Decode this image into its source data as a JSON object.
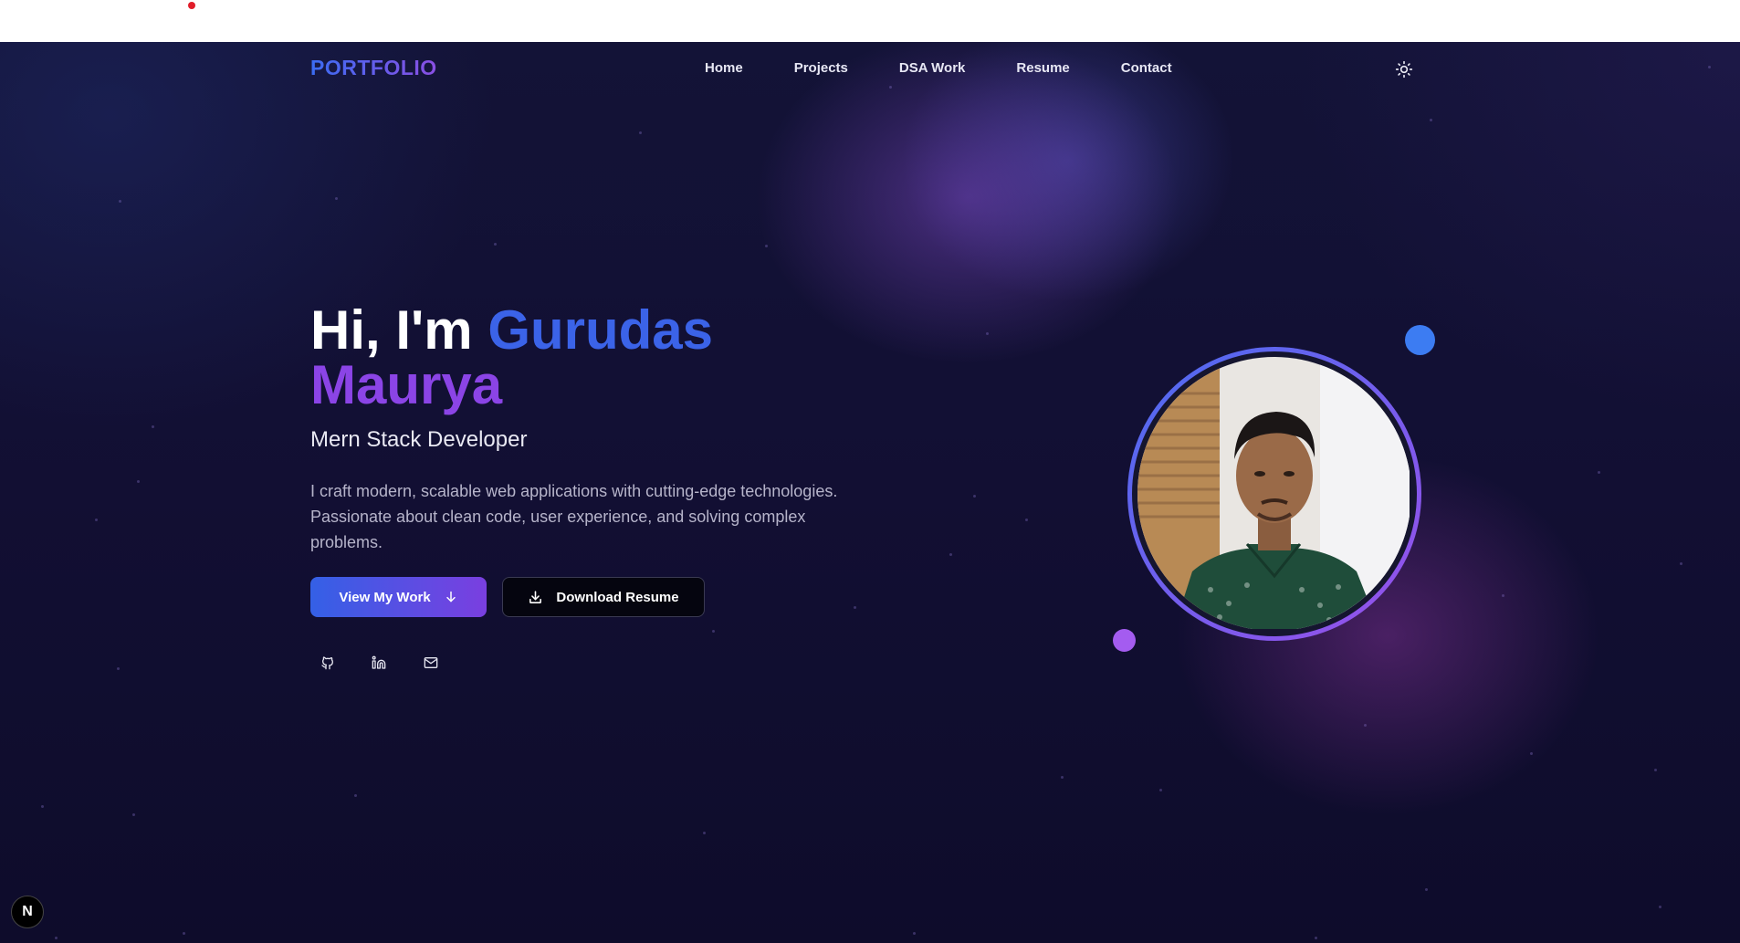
{
  "colors": {
    "accent_blue": "#3b63e8",
    "accent_purple": "#8b44e6",
    "background": "#0d0d2b",
    "recording_dot": "#e11d2a"
  },
  "header": {
    "logo": "PORTFOLIO",
    "nav": [
      "Home",
      "Projects",
      "DSA Work",
      "Resume",
      "Contact"
    ],
    "theme_toggle_icon": "sun-icon"
  },
  "hero": {
    "greeting": "Hi, I'm",
    "first_name": "Gurudas",
    "last_name": "Maurya",
    "role": "Mern Stack Developer",
    "description": "I craft modern, scalable web applications with cutting-edge technologies. Passionate about clean code, user experience, and solving complex problems.",
    "primary_button": "View My Work",
    "secondary_button": "Download Resume",
    "social_icons": [
      "github-icon",
      "linkedin-icon",
      "mail-icon"
    ]
  },
  "dev_badge": "N"
}
